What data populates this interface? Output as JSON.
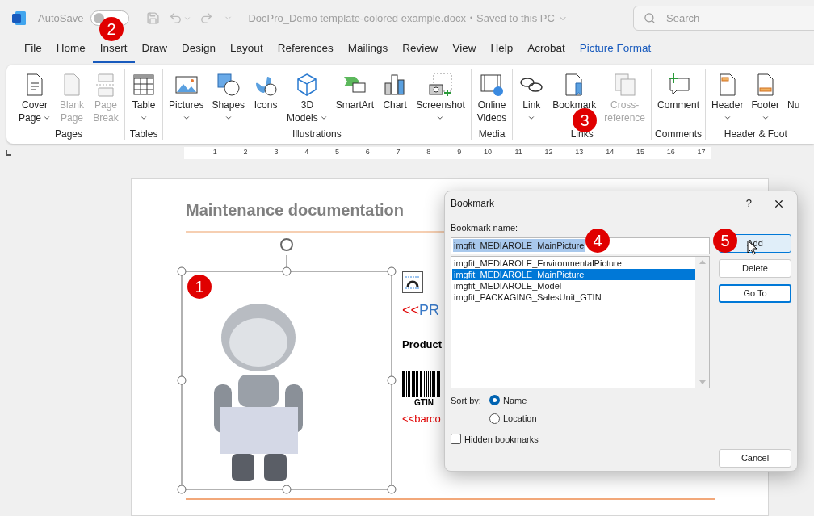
{
  "title_bar": {
    "autosave_label": "AutoSave",
    "autosave_on": false,
    "document_title": "DocPro_Demo template-colored example.docx",
    "separator": "•",
    "save_status": "Saved to this PC",
    "search_placeholder": "Search"
  },
  "tabs": [
    {
      "label": "File",
      "selected": false,
      "contextual": false
    },
    {
      "label": "Home",
      "selected": false,
      "contextual": false
    },
    {
      "label": "Insert",
      "selected": true,
      "contextual": false
    },
    {
      "label": "Draw",
      "selected": false,
      "contextual": false
    },
    {
      "label": "Design",
      "selected": false,
      "contextual": false
    },
    {
      "label": "Layout",
      "selected": false,
      "contextual": false
    },
    {
      "label": "References",
      "selected": false,
      "contextual": false
    },
    {
      "label": "Mailings",
      "selected": false,
      "contextual": false
    },
    {
      "label": "Review",
      "selected": false,
      "contextual": false
    },
    {
      "label": "View",
      "selected": false,
      "contextual": false
    },
    {
      "label": "Help",
      "selected": false,
      "contextual": false
    },
    {
      "label": "Acrobat",
      "selected": false,
      "contextual": false
    },
    {
      "label": "Picture Format",
      "selected": false,
      "contextual": true
    }
  ],
  "ribbon": {
    "groups": [
      {
        "label": "Pages",
        "buttons": [
          {
            "lines": [
              "Cover",
              "Page"
            ],
            "dropdown": true,
            "disabled": false
          },
          {
            "lines": [
              "Blank",
              "Page"
            ],
            "dropdown": false,
            "disabled": true
          },
          {
            "lines": [
              "Page",
              "Break"
            ],
            "dropdown": false,
            "disabled": true
          }
        ]
      },
      {
        "label": "Tables",
        "buttons": [
          {
            "lines": [
              "Table"
            ],
            "dropdown": true,
            "disabled": false
          }
        ]
      },
      {
        "label": "Illustrations",
        "buttons": [
          {
            "lines": [
              "Pictures"
            ],
            "dropdown": true,
            "disabled": false
          },
          {
            "lines": [
              "Shapes"
            ],
            "dropdown": true,
            "disabled": false
          },
          {
            "lines": [
              "Icons"
            ],
            "dropdown": false,
            "disabled": false
          },
          {
            "lines": [
              "3D",
              "Models"
            ],
            "dropdown": true,
            "disabled": false
          },
          {
            "lines": [
              "SmartArt"
            ],
            "dropdown": false,
            "disabled": false
          },
          {
            "lines": [
              "Chart"
            ],
            "dropdown": false,
            "disabled": false
          },
          {
            "lines": [
              "Screenshot"
            ],
            "dropdown": true,
            "disabled": false
          }
        ]
      },
      {
        "label": "Media",
        "buttons": [
          {
            "lines": [
              "Online",
              "Videos"
            ],
            "dropdown": false,
            "disabled": false
          }
        ]
      },
      {
        "label": "Links",
        "buttons": [
          {
            "lines": [
              "Link"
            ],
            "dropdown": true,
            "disabled": false
          },
          {
            "lines": [
              "Bookmark"
            ],
            "dropdown": false,
            "disabled": false
          },
          {
            "lines": [
              "Cross-",
              "reference"
            ],
            "dropdown": false,
            "disabled": true
          }
        ]
      },
      {
        "label": "Comments",
        "buttons": [
          {
            "lines": [
              "Comment"
            ],
            "dropdown": false,
            "disabled": false
          }
        ]
      },
      {
        "label": "Header & Foot",
        "buttons": [
          {
            "lines": [
              "Header"
            ],
            "dropdown": true,
            "disabled": false
          },
          {
            "lines": [
              "Footer"
            ],
            "dropdown": true,
            "disabled": false
          },
          {
            "lines": [
              "Nu"
            ],
            "dropdown": false,
            "disabled": false
          }
        ]
      }
    ]
  },
  "ruler": {
    "ticks": [
      "1",
      "2",
      "3",
      "4",
      "5",
      "6",
      "7",
      "8",
      "9",
      "10",
      "11",
      "12",
      "13",
      "14",
      "15",
      "16",
      "17"
    ]
  },
  "document": {
    "heading": "Maintenance documentation",
    "image": {
      "selected": true
    },
    "field_marker": "<<",
    "field_text": "PR",
    "label": "Product",
    "barcode_caption": "GTIN",
    "barcode_field": "<<barco"
  },
  "dialog": {
    "title": "Bookmark",
    "help": "?",
    "name_label": "Bookmark name:",
    "name_value": "imgfit_MEDIAROLE_MainPicture",
    "items": [
      {
        "label": "imgfit_MEDIAROLE_EnvironmentalPicture",
        "selected": false
      },
      {
        "label": "imgfit_MEDIAROLE_MainPicture",
        "selected": true
      },
      {
        "label": "imgfit_MEDIAROLE_Model",
        "selected": false
      },
      {
        "label": "imgfit_PACKAGING_SalesUnit_GTIN",
        "selected": false
      }
    ],
    "sort_label": "Sort by:",
    "sort_options": [
      {
        "label": "Name",
        "selected": true
      },
      {
        "label": "Location",
        "selected": false
      }
    ],
    "hidden": {
      "label": "Hidden bookmarks",
      "checked": false
    },
    "buttons": [
      {
        "label": "Add",
        "highlighted": true,
        "focused": false
      },
      {
        "label": "Delete",
        "highlighted": false,
        "focused": false
      },
      {
        "label": "Go To",
        "highlighted": false,
        "focused": true
      }
    ],
    "cancel": "Cancel"
  },
  "callouts": [
    "1",
    "2",
    "3",
    "4",
    "5"
  ]
}
